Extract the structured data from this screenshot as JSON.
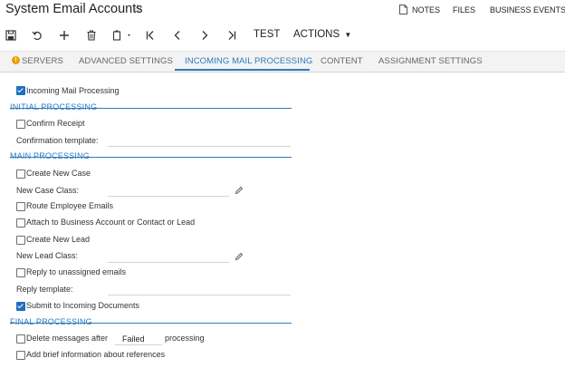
{
  "header": {
    "title": "System Email Accounts",
    "links": {
      "notes": "NOTES",
      "files": "FILES",
      "business_events": "BUSINESS EVENTS"
    }
  },
  "toolbar": {
    "icons": [
      "save-icon",
      "undo-icon",
      "add-icon",
      "delete-icon",
      "copy-paste-icon",
      "first-icon",
      "previous-icon",
      "next-icon",
      "last-icon"
    ],
    "test_label": "TEST",
    "actions_label": "ACTIONS"
  },
  "tabs": [
    {
      "label": "SERVERS",
      "active": false,
      "warning": true
    },
    {
      "label": "ADVANCED SETTINGS",
      "active": false
    },
    {
      "label": "INCOMING MAIL PROCESSING",
      "active": true
    },
    {
      "label": "CONTENT",
      "active": false
    },
    {
      "label": "ASSIGNMENT SETTINGS",
      "active": false
    }
  ],
  "form": {
    "incoming_mail_processing": {
      "label": "Incoming Mail Processing",
      "checked": true
    },
    "initial": {
      "heading": "INITIAL PROCESSING",
      "confirm_receipt": {
        "label": "Confirm Receipt",
        "checked": false
      },
      "confirmation_template": {
        "label": "Confirmation template:",
        "value": ""
      }
    },
    "main": {
      "heading": "MAIN PROCESSING",
      "create_new_case": {
        "label": "Create New Case",
        "checked": false
      },
      "new_case_class": {
        "label": "New Case Class:",
        "value": ""
      },
      "route_employee_emails": {
        "label": "Route Employee Emails",
        "checked": false
      },
      "attach_to_account": {
        "label": "Attach to Business Account or Contact or Lead",
        "checked": false
      },
      "create_new_lead": {
        "label": "Create New Lead",
        "checked": false
      },
      "new_lead_class": {
        "label": "New Lead Class:",
        "value": ""
      },
      "reply_unassigned": {
        "label": "Reply to unassigned emails",
        "checked": false
      },
      "reply_template": {
        "label": "Reply template:",
        "value": ""
      },
      "submit_incoming_docs": {
        "label": "Submit to Incoming Documents",
        "checked": true
      }
    },
    "final": {
      "heading": "FINAL PROCESSING",
      "delete_messages": {
        "label": "Delete messages after",
        "checked": false,
        "value": "Failed",
        "suffix": "processing"
      },
      "add_brief_info": {
        "label": "Add brief information about references",
        "checked": false
      }
    }
  },
  "colors": {
    "accent": "#2b7bc0",
    "checkbox_checked": "#1f6fbf",
    "warning": "#e8a000"
  }
}
